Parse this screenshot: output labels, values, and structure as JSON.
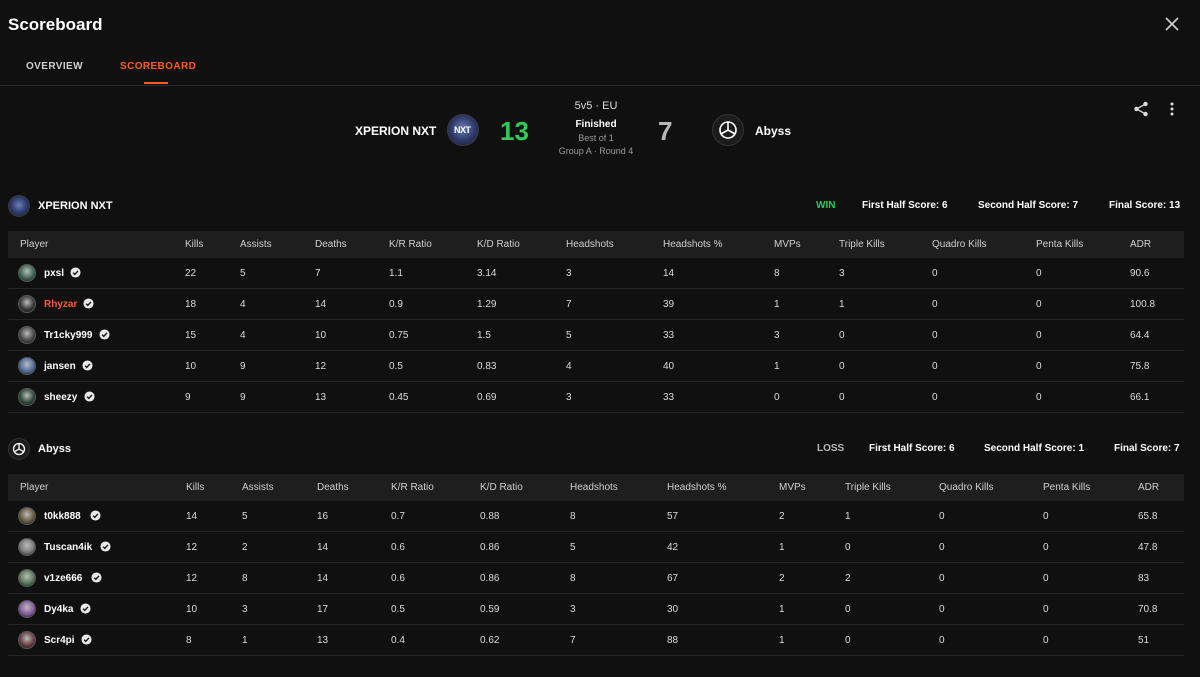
{
  "window": {
    "title": "Scoreboard"
  },
  "tabs": [
    {
      "label": "OVERVIEW",
      "active": false
    },
    {
      "label": "SCOREBOARD",
      "active": true
    }
  ],
  "match": {
    "format": "5v5 · EU",
    "status": "Finished",
    "best_of": "Best of 1",
    "group": "Group A · Round 4",
    "team1": {
      "name": "XPERION NXT",
      "score": "13"
    },
    "team2": {
      "name": "Abyss",
      "score": "7"
    }
  },
  "colors": {
    "accent": "#ff5a1f",
    "win": "#2ecc55",
    "loss": "#b8b8b8",
    "highlight_player": "#ff5a3a"
  },
  "icons": {
    "close": "close-icon",
    "share": "share-icon",
    "more": "more-vertical-icon",
    "verified": "verified-check-icon"
  },
  "columns": [
    "Player",
    "Kills",
    "Assists",
    "Deaths",
    "K/R Ratio",
    "K/D Ratio",
    "Headshots",
    "Headshots %",
    "MVPs",
    "Triple Kills",
    "Quadro Kills",
    "Penta Kills",
    "ADR"
  ],
  "teams": [
    {
      "name": "XPERION NXT",
      "result": "WIN",
      "first_half": "First Half Score: 6",
      "second_half": "Second Half Score: 7",
      "final": "Final Score: 13",
      "players": [
        {
          "name": "pxsl",
          "stats": [
            "22",
            "5",
            "7",
            "1.1",
            "3.14",
            "3",
            "14",
            "8",
            "3",
            "0",
            "0",
            "90.6"
          ]
        },
        {
          "name": "Rhyzar",
          "highlight": true,
          "stats": [
            "18",
            "4",
            "14",
            "0.9",
            "1.29",
            "7",
            "39",
            "1",
            "1",
            "0",
            "0",
            "100.8"
          ]
        },
        {
          "name": "Tr1cky999",
          "stats": [
            "15",
            "4",
            "10",
            "0.75",
            "1.5",
            "5",
            "33",
            "3",
            "0",
            "0",
            "0",
            "64.4"
          ]
        },
        {
          "name": "jansen",
          "stats": [
            "10",
            "9",
            "12",
            "0.5",
            "0.83",
            "4",
            "40",
            "1",
            "0",
            "0",
            "0",
            "75.8"
          ]
        },
        {
          "name": "sheezy",
          "stats": [
            "9",
            "9",
            "13",
            "0.45",
            "0.69",
            "3",
            "33",
            "0",
            "0",
            "0",
            "0",
            "66.1"
          ]
        }
      ]
    },
    {
      "name": "Abyss",
      "result": "LOSS",
      "first_half": "First Half Score: 6",
      "second_half": "Second Half Score: 1",
      "final": "Final Score: 7",
      "players": [
        {
          "name": "t0kk888",
          "stats": [
            "14",
            "5",
            "16",
            "0.7",
            "0.88",
            "8",
            "57",
            "2",
            "1",
            "0",
            "0",
            "65.8"
          ]
        },
        {
          "name": "Tuscan4ik",
          "stats": [
            "12",
            "2",
            "14",
            "0.6",
            "0.86",
            "5",
            "42",
            "1",
            "0",
            "0",
            "0",
            "47.8"
          ]
        },
        {
          "name": "v1ze666",
          "stats": [
            "12",
            "8",
            "14",
            "0.6",
            "0.86",
            "8",
            "67",
            "2",
            "2",
            "0",
            "0",
            "83"
          ]
        },
        {
          "name": "Dy4ka",
          "stats": [
            "10",
            "3",
            "17",
            "0.5",
            "0.59",
            "3",
            "30",
            "1",
            "0",
            "0",
            "0",
            "70.8"
          ]
        },
        {
          "name": "Scr4pi",
          "stats": [
            "8",
            "1",
            "13",
            "0.4",
            "0.62",
            "7",
            "88",
            "1",
            "0",
            "0",
            "0",
            "51"
          ]
        }
      ]
    }
  ]
}
